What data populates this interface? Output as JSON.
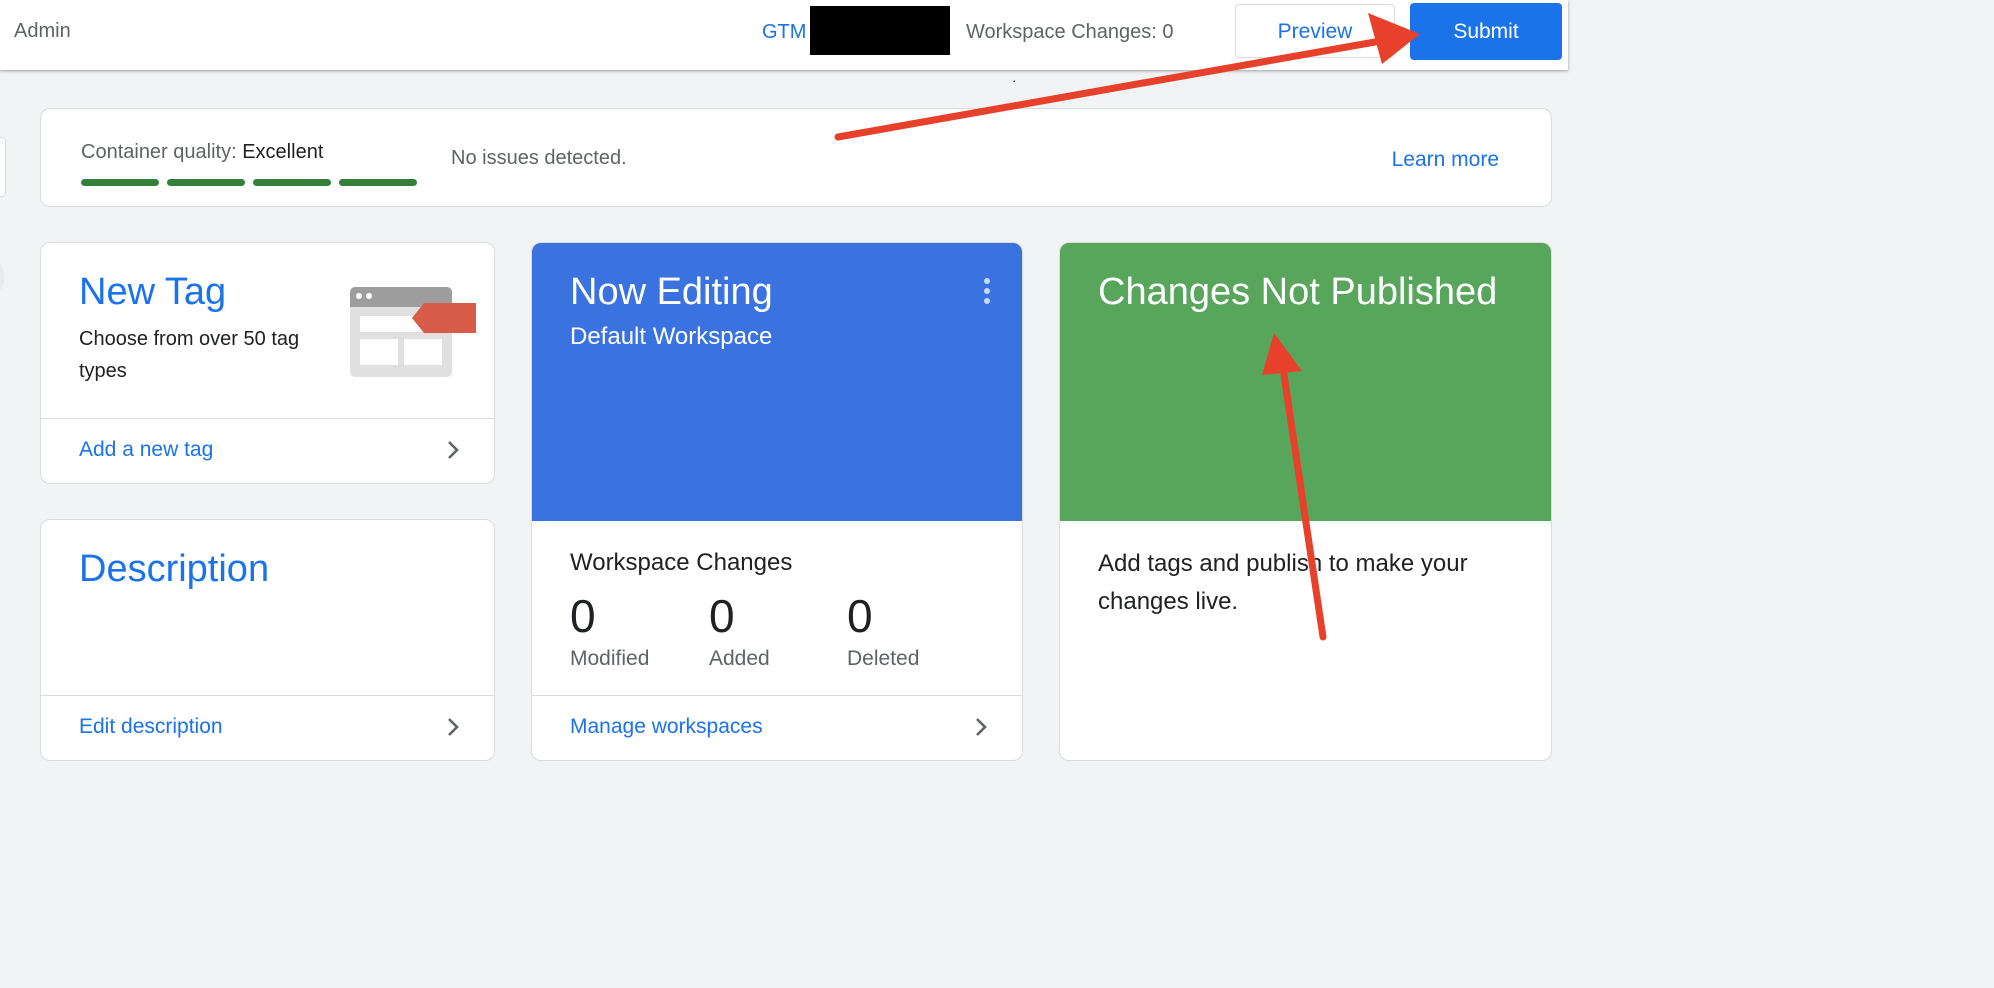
{
  "topbar": {
    "admin_label": "Admin",
    "container_prefix": "GTM",
    "workspace_changes": "Workspace Changes: 0",
    "preview_label": "Preview",
    "submit_label": "Submit"
  },
  "quality": {
    "label": "Container quality:",
    "value": "Excellent",
    "issues": "No issues detected.",
    "learn_more": "Learn more",
    "bars_filled": 4
  },
  "new_tag": {
    "title": "New Tag",
    "subtitle": "Choose from over 50 tag types",
    "link": "Add a new tag"
  },
  "description": {
    "title": "Description",
    "link": "Edit description"
  },
  "now_editing": {
    "title": "Now Editing",
    "workspace": "Default Workspace",
    "changes_heading": "Workspace Changes",
    "stats": [
      {
        "value": "0",
        "label": "Modified"
      },
      {
        "value": "0",
        "label": "Added"
      },
      {
        "value": "0",
        "label": "Deleted"
      }
    ],
    "link": "Manage workspaces"
  },
  "not_published": {
    "title": "Changes Not Published",
    "body": "Add tags and publish to make your changes live."
  },
  "colors": {
    "accent_blue": "#1a73e8",
    "editing_blue": "#3a73e0",
    "published_green": "#58a55c",
    "quality_green": "#34803a",
    "annotation_red": "#e8412b"
  },
  "icons": {
    "chevron": "chevron-right-icon",
    "menu": "more-vert-icon",
    "tag_illustration": "tag-illustration"
  }
}
